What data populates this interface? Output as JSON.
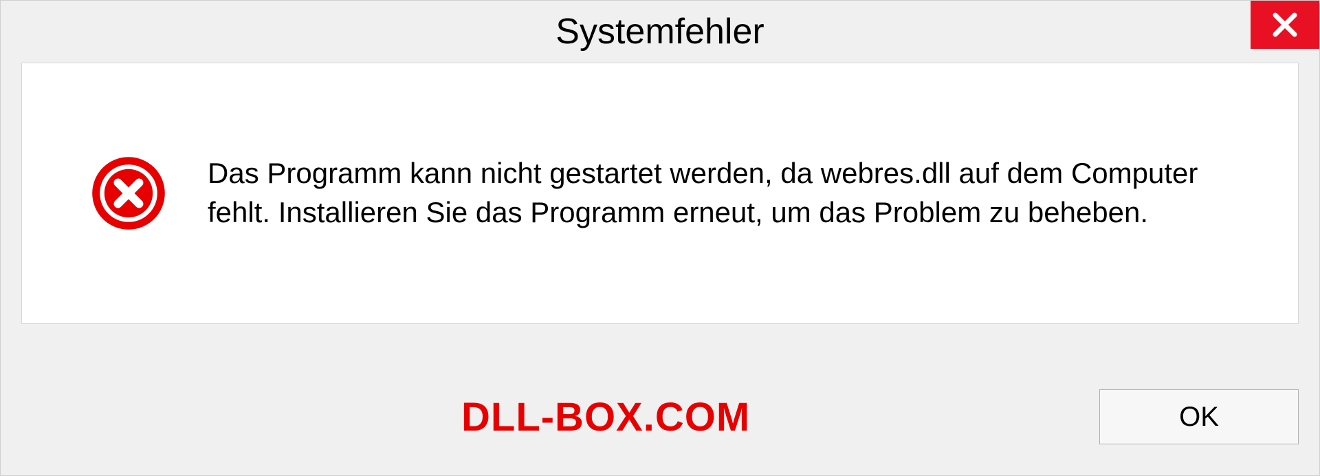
{
  "dialog": {
    "title": "Systemfehler",
    "message": "Das Programm kann nicht gestartet werden, da webres.dll auf dem Computer fehlt. Installieren Sie das Programm erneut, um das Problem zu beheben.",
    "ok_label": "OK"
  },
  "watermark": "DLL-BOX.COM",
  "colors": {
    "close_bg": "#e81123",
    "error_red": "#e60000",
    "watermark_red": "#e60000"
  }
}
